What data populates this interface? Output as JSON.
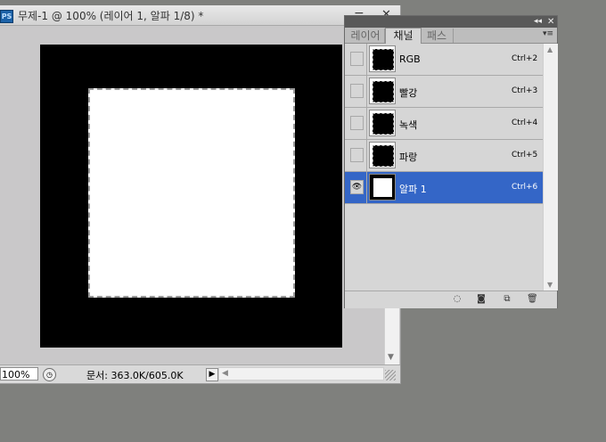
{
  "document": {
    "app_icon": "PS",
    "title": "무제-1 @ 100% (레이어 1, 알파 1/8) *",
    "minimize_glyph": "−",
    "close_glyph": "✕",
    "zoom": "100%",
    "doc_size": "문서: 363.0K/605.0K",
    "status_arrow": "▶"
  },
  "panel": {
    "collapse_glyph": "◂◂",
    "close_glyph": "✕",
    "menu_glyph": "▾≡",
    "tabs": [
      {
        "label": "레이어",
        "active": false
      },
      {
        "label": "채널",
        "active": true
      },
      {
        "label": "패스",
        "active": false
      }
    ],
    "channels": [
      {
        "name": "RGB",
        "shortcut": "Ctrl+2",
        "visible": false,
        "selected": false,
        "type": "composite"
      },
      {
        "name": "빨강",
        "shortcut": "Ctrl+3",
        "visible": false,
        "selected": false,
        "type": "color"
      },
      {
        "name": "녹색",
        "shortcut": "Ctrl+4",
        "visible": false,
        "selected": false,
        "type": "color"
      },
      {
        "name": "파랑",
        "shortcut": "Ctrl+5",
        "visible": false,
        "selected": false,
        "type": "color"
      },
      {
        "name": "알파 1",
        "shortcut": "Ctrl+6",
        "visible": true,
        "selected": true,
        "type": "alpha"
      }
    ],
    "footer_icons": [
      "load-channel-as-selection-icon",
      "save-selection-as-channel-icon",
      "new-channel-icon",
      "delete-channel-icon"
    ]
  },
  "colors": {
    "workspace": "#7f807d",
    "selection": "#3466c7",
    "panel_bg": "#d6d6d6"
  }
}
